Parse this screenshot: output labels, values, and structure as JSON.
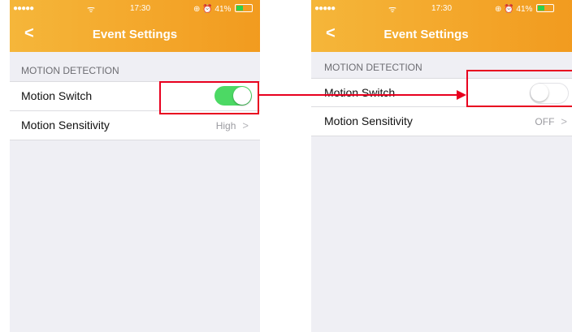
{
  "left_screen": {
    "status_bar": {
      "signal": "●●●●●",
      "wifi": "ᯤ",
      "time": "17:30",
      "icons": "⊕ ⏰ 41%",
      "battery_percent": 41
    },
    "nav": {
      "back_icon": "chevron-left-icon",
      "back_glyph": "<",
      "title": "Event Settings"
    },
    "section_header": "MOTION DETECTION",
    "motion_switch": {
      "label": "Motion Switch",
      "state": "on"
    },
    "motion_sensitivity": {
      "label": "Motion Sensitivity",
      "value": "High",
      "chevron": ">"
    }
  },
  "right_screen": {
    "status_bar": {
      "signal": "●●●●●",
      "wifi": "ᯤ",
      "time": "17:30",
      "icons": "⊕ ⏰ 41%",
      "battery_percent": 41
    },
    "nav": {
      "back_icon": "chevron-left-icon",
      "back_glyph": "<",
      "title": "Event Settings"
    },
    "section_header": "MOTION DETECTION",
    "motion_switch": {
      "label": "Motion Switch",
      "state": "off"
    },
    "motion_sensitivity": {
      "label": "Motion Sensitivity",
      "value": "OFF",
      "chevron": ">"
    }
  },
  "colors": {
    "nav_orange": "#f29b1f",
    "toggle_on": "#4cd964",
    "annotation_red": "#e8001f",
    "background": "#efeff4"
  }
}
